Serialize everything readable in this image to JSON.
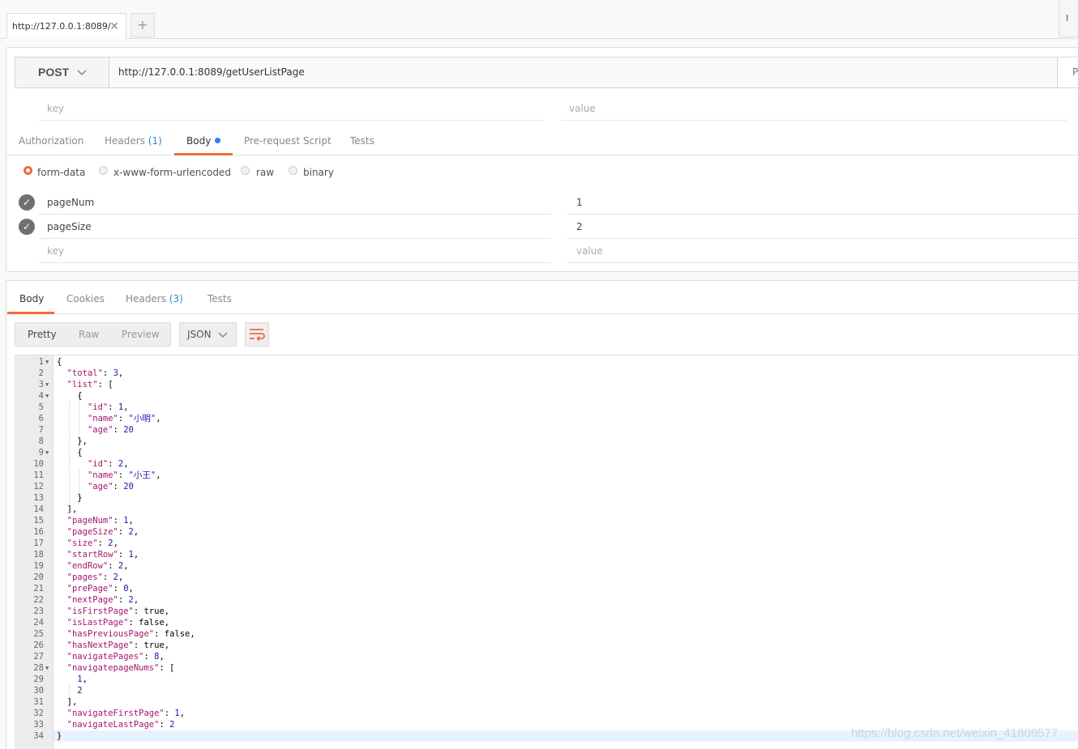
{
  "tabbar": {
    "tab_title": "http://127.0.0.1:8089/",
    "close_glyph": "✕",
    "new_tab_glyph": "+",
    "corner_label": "I"
  },
  "request": {
    "method": "POST",
    "url": "http://127.0.0.1:8089/getUserListPage",
    "params_label": "P",
    "url_params": {
      "key_placeholder": "key",
      "value_placeholder": "value"
    },
    "tabs": [
      {
        "label": "Authorization",
        "badge": ""
      },
      {
        "label": "Headers",
        "badge": "(1)"
      },
      {
        "label": "Body",
        "badge": ""
      },
      {
        "label": "Pre-request Script",
        "badge": ""
      },
      {
        "label": "Tests",
        "badge": ""
      }
    ],
    "body_modes": [
      "form-data",
      "x-www-form-urlencoded",
      "raw",
      "binary"
    ],
    "form_rows": [
      {
        "key": "pageNum",
        "value": "1"
      },
      {
        "key": "pageSize",
        "value": "2"
      }
    ],
    "form_new": {
      "key_placeholder": "key",
      "value_placeholder": "value"
    }
  },
  "response": {
    "tabs": [
      {
        "label": "Body",
        "badge": ""
      },
      {
        "label": "Cookies",
        "badge": ""
      },
      {
        "label": "Headers",
        "badge": "(3)"
      },
      {
        "label": "Tests",
        "badge": ""
      }
    ],
    "view_modes": [
      "Pretty",
      "Raw",
      "Preview"
    ],
    "format": "JSON",
    "lines": [
      "{",
      "  \"total\": 3,",
      "  \"list\": [",
      "    {",
      "      \"id\": 1,",
      "      \"name\": \"小明\",",
      "      \"age\": 20",
      "    },",
      "    {",
      "      \"id\": 2,",
      "      \"name\": \"小王\",",
      "      \"age\": 20",
      "    }",
      "  ],",
      "  \"pageNum\": 1,",
      "  \"pageSize\": 2,",
      "  \"size\": 2,",
      "  \"startRow\": 1,",
      "  \"endRow\": 2,",
      "  \"pages\": 2,",
      "  \"prePage\": 0,",
      "  \"nextPage\": 2,",
      "  \"isFirstPage\": true,",
      "  \"isLastPage\": false,",
      "  \"hasPreviousPage\": false,",
      "  \"hasNextPage\": true,",
      "  \"navigatePages\": 8,",
      "  \"navigatepageNums\": [",
      "    1,",
      "    2",
      "  ],",
      "  \"navigateFirstPage\": 1,",
      "  \"navigateLastPage\": 2",
      "}"
    ],
    "fold_lines": [
      1,
      3,
      4,
      9,
      28
    ]
  },
  "watermark": "https://blog.csdn.net/weixin_41809577",
  "colors": {
    "accent": "#f26b3a",
    "badge_blue": "#2a8ad4",
    "json_key": "#a31571",
    "json_value": "#1a1aa6"
  }
}
